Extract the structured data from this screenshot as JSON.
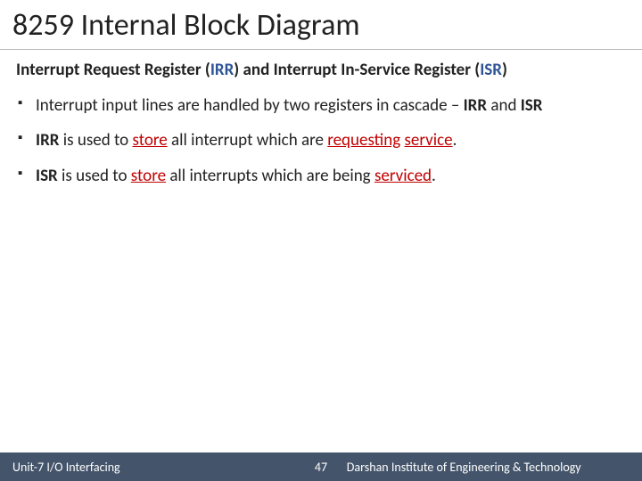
{
  "title": "8259 Internal Block Diagram",
  "section": {
    "pre1": "Interrupt Request Register (",
    "abbr1": "IRR",
    "mid": ") and Interrupt In-Service Register (",
    "abbr2": "ISR",
    "post": ")"
  },
  "bullet1": {
    "t1": "Interrupt input lines are handled by two registers in cascade – ",
    "b1": "IRR",
    "t2": " and ",
    "b2": "ISR"
  },
  "bullet2": {
    "b1": "IRR",
    "t1": " is used to ",
    "r1": "store",
    "t2": " all interrupt which are ",
    "r2": "requesting",
    "t3": " ",
    "r3": "service",
    "t4": "."
  },
  "bullet3": {
    "b1": "ISR",
    "t1": " is used to ",
    "r1": "store",
    "t2": " all interrupts which are being ",
    "r2": "serviced",
    "t3": "."
  },
  "footer": {
    "left": "Unit-7 I/O Interfacing",
    "page": "47",
    "right": "Darshan Institute of Engineering & Technology"
  }
}
